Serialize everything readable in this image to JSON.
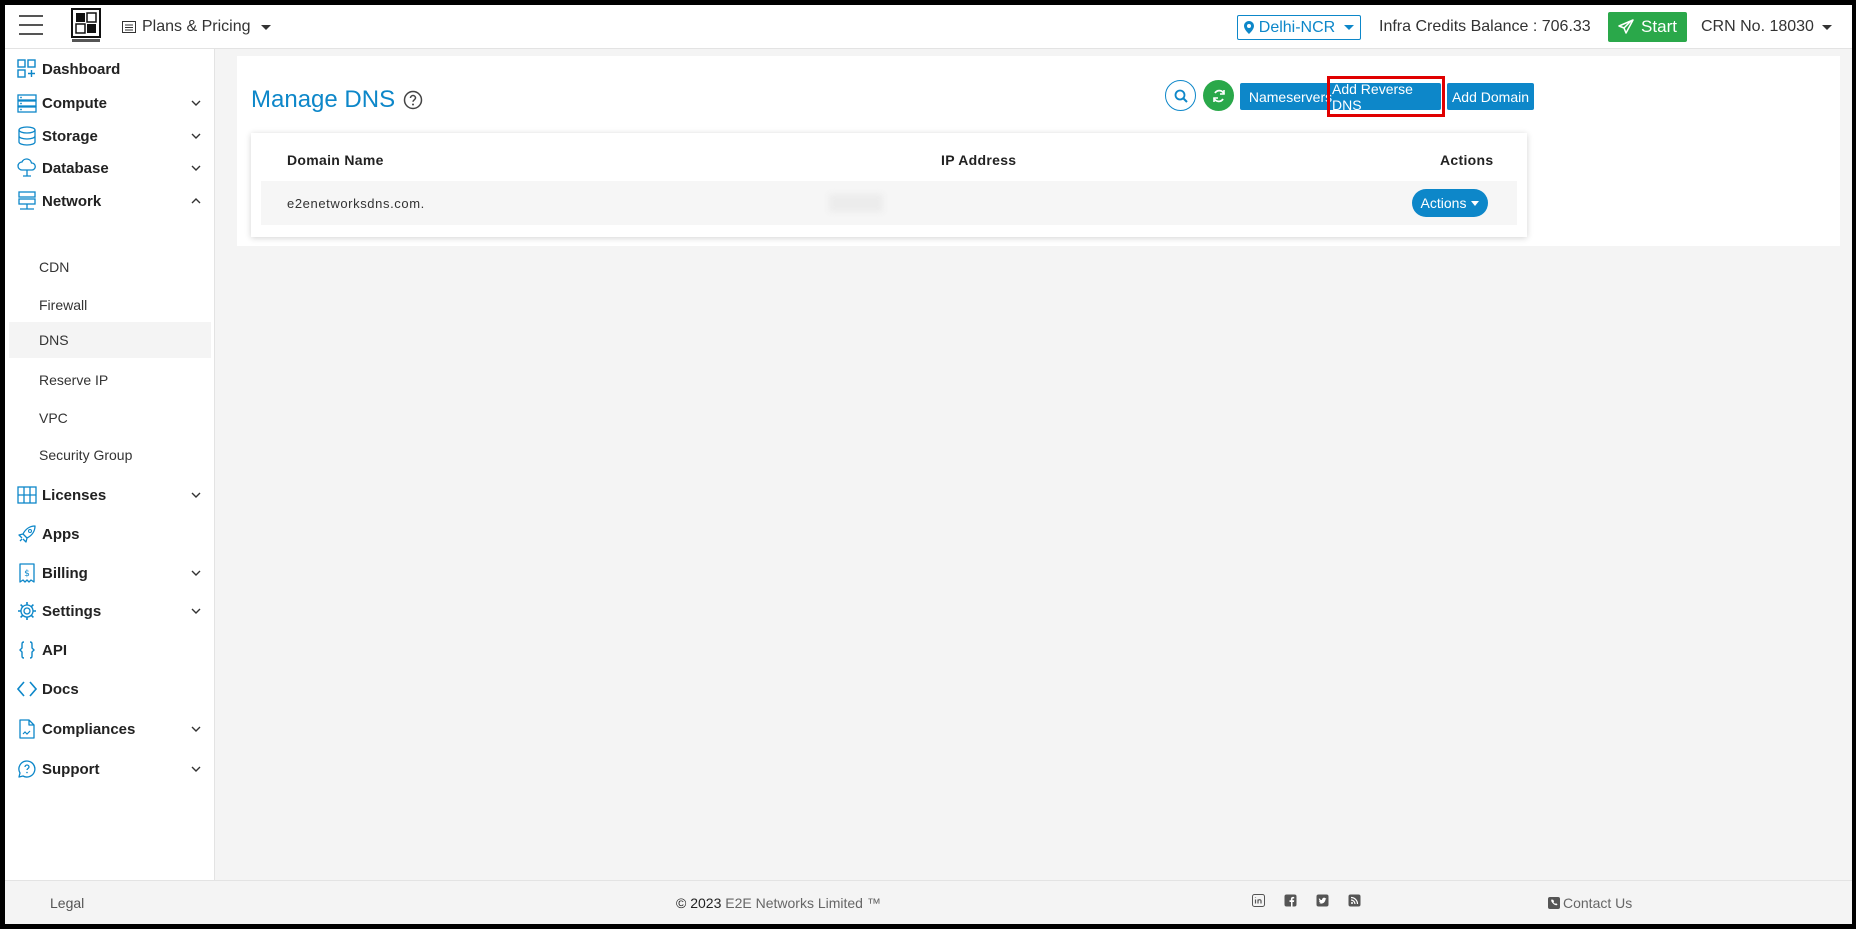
{
  "header": {
    "plans_label": "Plans & Pricing",
    "region": "Delhi-NCR",
    "credits": "Infra Credits Balance : 706.33",
    "start_label": "Start",
    "crn": "CRN No. 18030"
  },
  "sidebar": {
    "items": [
      {
        "label": "Dashboard"
      },
      {
        "label": "Compute"
      },
      {
        "label": "Storage"
      },
      {
        "label": "Database"
      },
      {
        "label": "Network"
      },
      {
        "label": "Licenses"
      },
      {
        "label": "Apps"
      },
      {
        "label": "Billing"
      },
      {
        "label": "Settings"
      },
      {
        "label": "API"
      },
      {
        "label": "Docs"
      },
      {
        "label": "Compliances"
      },
      {
        "label": "Support"
      }
    ],
    "network_sub": [
      {
        "label": "CDN"
      },
      {
        "label": "Firewall"
      },
      {
        "label": "DNS"
      },
      {
        "label": "Reserve IP"
      },
      {
        "label": "VPC"
      },
      {
        "label": "Security Group"
      }
    ]
  },
  "main": {
    "title": "Manage DNS",
    "buttons": {
      "nameservers": "Nameservers",
      "add_reverse_dns": "Add Reverse DNS",
      "add_domain": "Add Domain"
    },
    "table": {
      "headers": [
        "Domain Name",
        "IP Address",
        "Actions"
      ],
      "rows": [
        {
          "domain": "e2enetworksdns.com.",
          "actions_label": "Actions"
        }
      ]
    }
  },
  "footer": {
    "legal": "Legal",
    "copyright_prefix": "© 2023",
    "copyright_company": "E2E Networks Limited ™",
    "contact": "Contact Us"
  },
  "colors": {
    "primary": "#0d87c9",
    "success": "#2aa84a",
    "highlight": "#e00000"
  }
}
